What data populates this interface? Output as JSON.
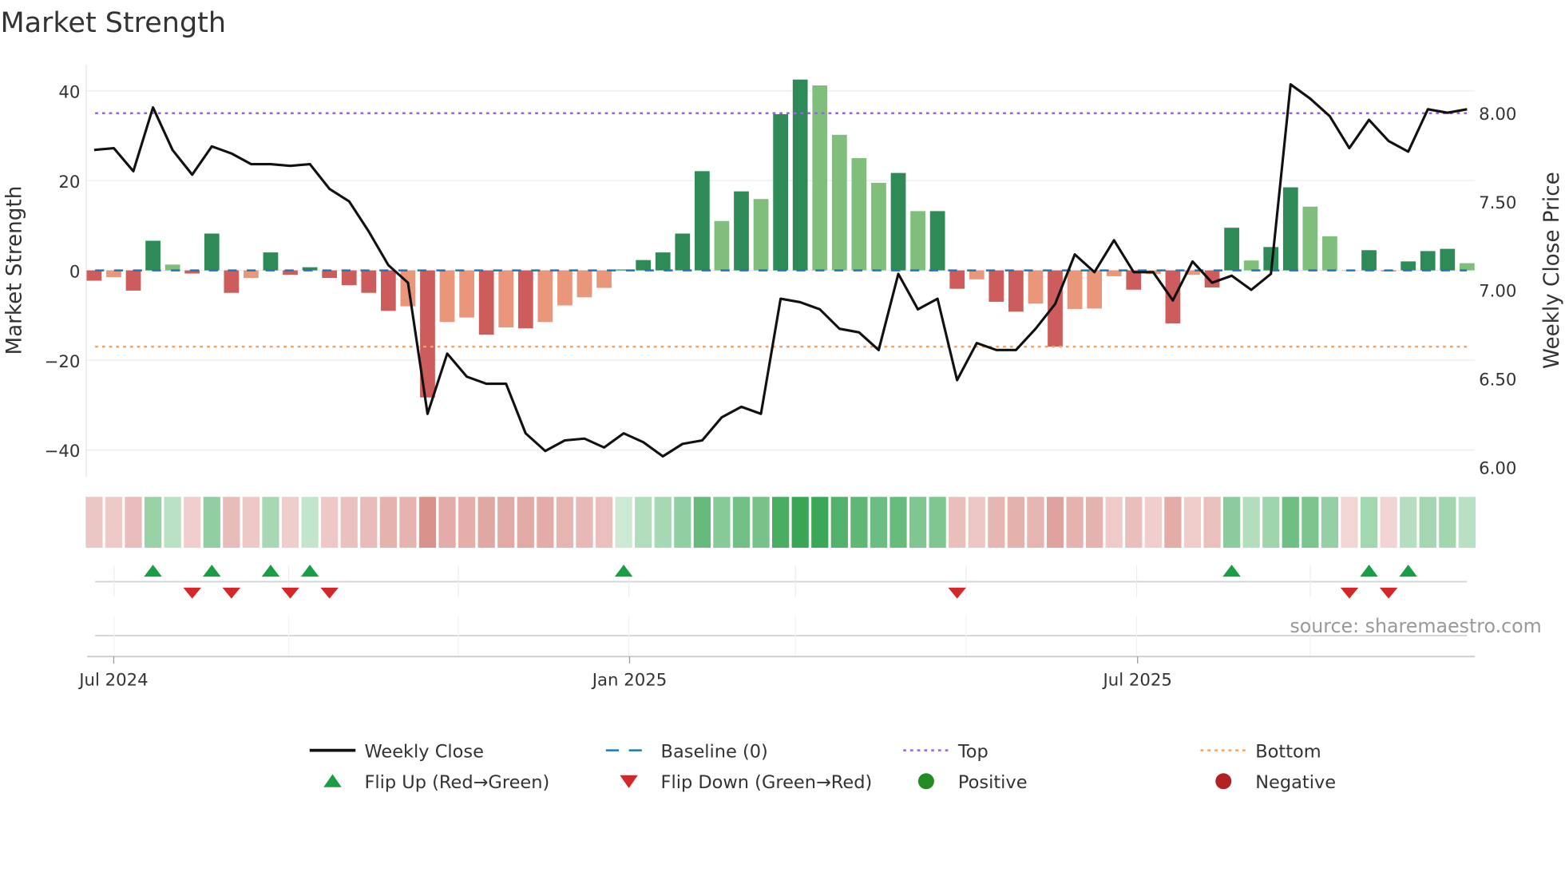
{
  "chart_data": {
    "type": "bar",
    "title": "Market Strength",
    "ylabel": "Market Strength",
    "y2label": "Weekly Close Price",
    "ylim": [
      -46,
      46
    ],
    "y2lim": [
      6.0,
      8.2
    ],
    "yticks": [
      "40",
      "20",
      "0",
      "−20",
      "−40"
    ],
    "ytick_values": [
      40,
      20,
      0,
      -20,
      -40
    ],
    "y2ticks": [
      "8.00",
      "7.50",
      "7.00",
      "6.50",
      "6.00"
    ],
    "y2tick_values": [
      8.0,
      7.5,
      7.0,
      6.5,
      6.0
    ],
    "x_frequency": "weekly",
    "xticks": [
      {
        "label": "Jul 2024",
        "week_index": 1.0
      },
      {
        "label": "Jan 2025",
        "week_index": 27.3
      },
      {
        "label": "Jul 2025",
        "week_index": 53.2
      }
    ],
    "grid": true,
    "top_level": 35,
    "bottom_level": -17,
    "baseline": 0,
    "strength": [
      -2.3,
      -1.5,
      -4.5,
      6.6,
      1.3,
      -0.7,
      8.2,
      -5.0,
      -1.7,
      4.0,
      -1.0,
      0.7,
      -1.7,
      -3.3,
      -5.0,
      -9.0,
      -8.0,
      -28.3,
      -11.5,
      -10.5,
      -14.3,
      -12.7,
      -12.9,
      -11.5,
      -7.8,
      -6.0,
      -3.9,
      0.2,
      2.3,
      4.0,
      8.2,
      22.1,
      11.0,
      17.6,
      15.9,
      34.8,
      42.5,
      41.2,
      30.2,
      25.0,
      19.5,
      21.7,
      13.2,
      13.2,
      -4.1,
      -2.0,
      -7.0,
      -9.2,
      -7.4,
      -17.0,
      -8.6,
      -8.5,
      -1.3,
      -4.3,
      -0.8,
      -11.8,
      -1.0,
      -3.8,
      9.5,
      2.2,
      5.2,
      18.5,
      14.2,
      7.6,
      -0.1,
      4.5,
      -0.2,
      2.0,
      4.3,
      4.8,
      1.6
    ],
    "shade": [
      "strong",
      "weak",
      "strong",
      "strong",
      "weak",
      "strong",
      "strong",
      "strong",
      "weak",
      "strong",
      "strong",
      "strong",
      "strong",
      "strong",
      "strong",
      "strong",
      "weak",
      "strong",
      "weak",
      "weak",
      "strong",
      "weak",
      "strong",
      "weak",
      "weak",
      "weak",
      "weak",
      "strong",
      "strong",
      "strong",
      "strong",
      "strong",
      "weak",
      "strong",
      "weak",
      "strong",
      "strong",
      "weak",
      "weak",
      "weak",
      "weak",
      "strong",
      "weak",
      "strong",
      "strong",
      "weak",
      "strong",
      "strong",
      "weak",
      "strong",
      "weak",
      "weak",
      "weak",
      "strong",
      "weak",
      "strong",
      "weak",
      "strong",
      "strong",
      "weak",
      "strong",
      "strong",
      "weak",
      "weak",
      "weak",
      "strong",
      "strong",
      "strong",
      "strong",
      "strong",
      "weak"
    ],
    "weekly_close": [
      7.79,
      7.8,
      7.67,
      8.03,
      7.79,
      7.65,
      7.81,
      7.77,
      7.71,
      7.71,
      7.7,
      7.71,
      7.57,
      7.5,
      7.33,
      7.14,
      7.04,
      6.3,
      6.64,
      6.51,
      6.47,
      6.47,
      6.19,
      6.09,
      6.15,
      6.16,
      6.11,
      6.19,
      6.14,
      6.06,
      6.13,
      6.15,
      6.28,
      6.34,
      6.3,
      6.95,
      6.93,
      6.89,
      6.78,
      6.76,
      6.66,
      7.09,
      6.89,
      6.95,
      6.49,
      6.7,
      6.66,
      6.66,
      6.78,
      6.92,
      7.2,
      7.1,
      7.28,
      7.1,
      7.1,
      6.94,
      7.16,
      7.04,
      7.08,
      7.0,
      7.09,
      8.16,
      8.08,
      7.98,
      7.8,
      7.96,
      7.84,
      7.78,
      8.02,
      8.0,
      8.02
    ],
    "flip_up_weeks": [
      3,
      6,
      9,
      11,
      27,
      58,
      65,
      67
    ],
    "flip_down_weeks": [
      5,
      7,
      10,
      12,
      44,
      64,
      66
    ],
    "legend": [
      {
        "label": "Weekly Close",
        "kind": "line"
      },
      {
        "label": "Baseline (0)",
        "kind": "dashed"
      },
      {
        "label": "Top",
        "kind": "dotted"
      },
      {
        "label": "Bottom",
        "kind": "dotted"
      },
      {
        "label": "Flip Up (Red→Green)",
        "kind": "triangle-up"
      },
      {
        "label": "Flip Down (Green→Red)",
        "kind": "triangle-down"
      },
      {
        "label": "Positive",
        "kind": "circle"
      },
      {
        "label": "Negative",
        "kind": "circle"
      }
    ],
    "legend_placement": "bottom",
    "source": "source: sharemaestro.com"
  },
  "colors": {
    "pos_strong": "#2e8b57",
    "pos_weak": "#7fbf7b",
    "neg_strong": "#cd5c5c",
    "neg_weak": "#e9967a",
    "close": "#111111",
    "baseline": "#1f77b4",
    "top": "#9467db",
    "bottom": "#f4a460",
    "flip_up": "#1a9e44",
    "flip_down": "#d62728",
    "positive": "#228b22",
    "negative": "#b22222"
  }
}
